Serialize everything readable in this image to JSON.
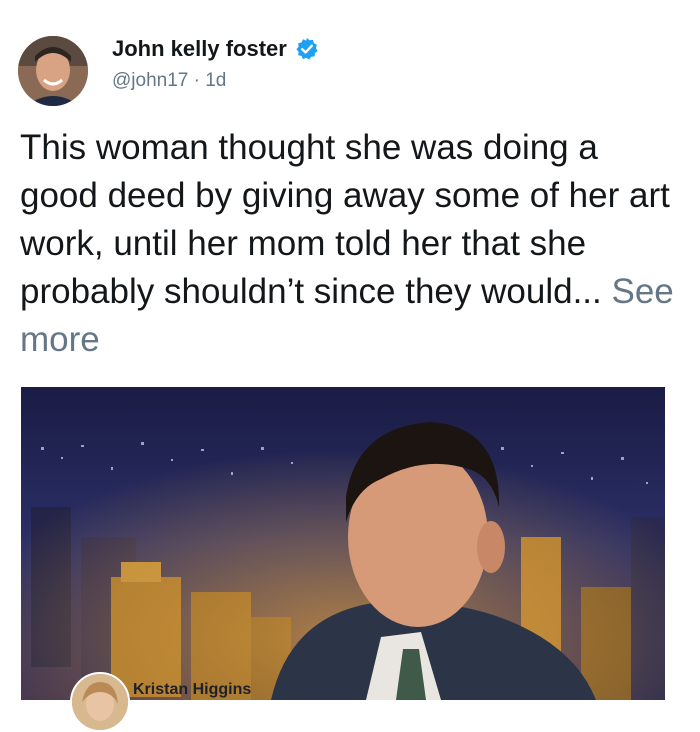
{
  "tweet": {
    "author_name": "John kelly foster",
    "handle": "@john17",
    "separator": " · ",
    "time": "1d",
    "text": "This woman thought she was doing a good deed by giving away some of her art work, until her mom told her that she probably shouldn’t since they would...",
    "see_more": "See more",
    "verified_icon": "verified-badge-icon",
    "verified_color": "#1da1f2"
  },
  "embedded_post": {
    "author_name": "Kristan Higgins"
  }
}
